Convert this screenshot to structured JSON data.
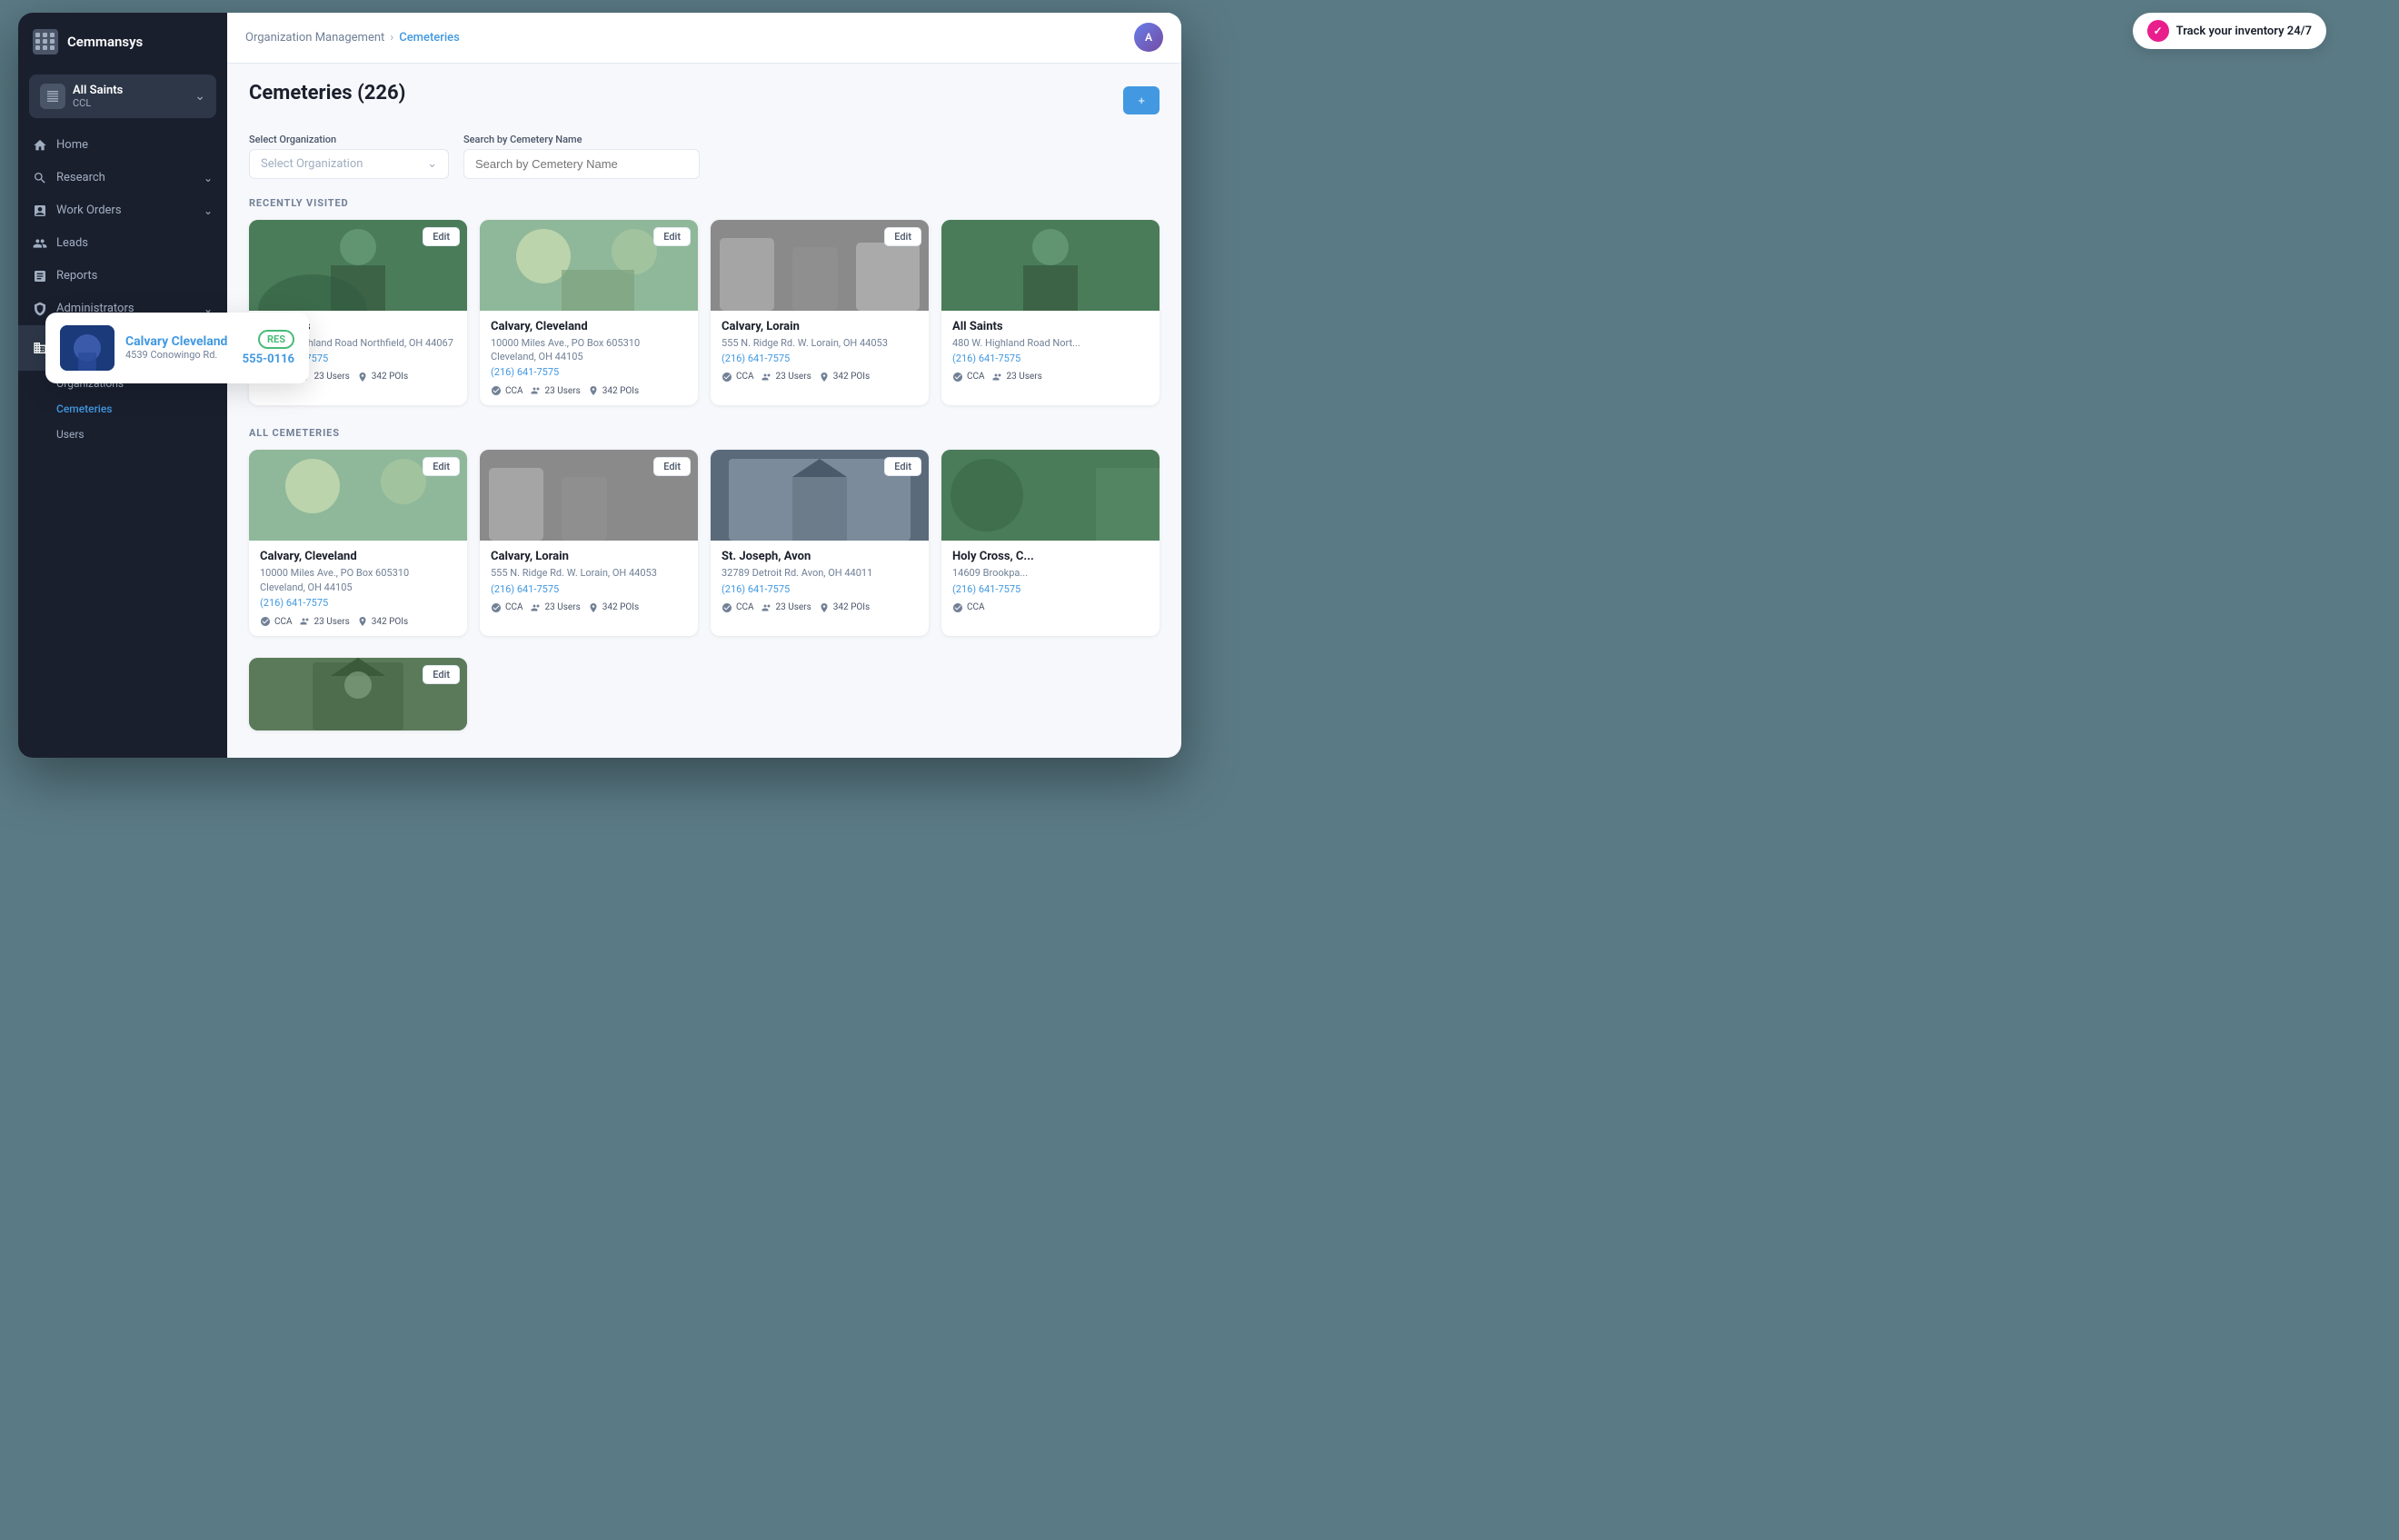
{
  "app": {
    "name": "Cemmansys"
  },
  "org": {
    "name": "All Saints",
    "code": "CCL"
  },
  "breadcrumb": {
    "parent": "Organization Management",
    "separator": "›",
    "current": "Cemeteries"
  },
  "page": {
    "title": "Cemeteries (226)"
  },
  "filters": {
    "org_label": "Select Organization",
    "org_placeholder": "Select Organization",
    "search_label": "Search by Cemetery Name",
    "search_placeholder": "Search by Cemetery Name"
  },
  "track_badge": "Track your inventory 24/7",
  "sections": {
    "recently_visited": "RECENTLY VISITED",
    "all_cemeteries": "ALL CEMETERIES"
  },
  "recently_visited": [
    {
      "name": "All Saints",
      "address": "480 W. Highland Road Northfield, OH 44067",
      "phone": "(216) 641-7575",
      "tags": [
        "CCA",
        "23 Users",
        "342 POIs"
      ],
      "img_class": "img-green"
    },
    {
      "name": "Calvary, Cleveland",
      "address": "10000 Miles Ave., PO Box 605310 Cleveland, OH 44105",
      "phone": "(216) 641-7575",
      "tags": [
        "CCA",
        "23 Users",
        "342 POIs"
      ],
      "img_class": "img-light-green"
    },
    {
      "name": "Calvary, Lorain",
      "address": "555 N. Ridge Rd. W. Lorain, OH 44053",
      "phone": "(216) 641-7575",
      "tags": [
        "CCA",
        "23 Users",
        "342 POIs"
      ],
      "img_class": "img-stone"
    },
    {
      "name": "All Saints",
      "address": "480 W. Highland Road Nort...",
      "phone": "(216) 641-7575",
      "tags": [
        "CCA",
        "23 Users"
      ],
      "img_class": "img-green"
    }
  ],
  "all_cemeteries": [
    {
      "name": "Calvary, Cleveland",
      "address": "10000 Miles Ave., PO Box 605310 Cleveland, OH 44105",
      "phone": "(216) 641-7575",
      "tags": [
        "CCA",
        "23 Users",
        "342 POIs"
      ],
      "img_class": "img-light-green"
    },
    {
      "name": "Calvary, Lorain",
      "address": "555 N. Ridge Rd. W. Lorain, OH 44053",
      "phone": "(216) 641-7575",
      "tags": [
        "CCA",
        "23 Users",
        "342 POIs"
      ],
      "img_class": "img-stone"
    },
    {
      "name": "St. Joseph, Avon",
      "address": "32789 Detroit Rd. Avon, OH 44011",
      "phone": "(216) 641-7575",
      "tags": [
        "CCA",
        "23 Users",
        "342 POIs"
      ],
      "img_class": "img-chapel"
    },
    {
      "name": "Holy Cross, C...",
      "address": "14609 Brookpa...",
      "phone": "(216) 641-7575",
      "tags": [
        "CCA"
      ],
      "img_class": "img-green"
    }
  ],
  "bottom_card": {
    "img_class": "img-chapel",
    "edit": "Edit"
  },
  "popup": {
    "title": "Calvary Cleveland",
    "address": "4539 Conowingo Rd.",
    "badge": "RES",
    "phone": "555-0116"
  },
  "nav": {
    "home": "Home",
    "research": "Research",
    "work_orders": "Work Orders",
    "leads": "Leads",
    "reports": "Reports",
    "administrators": "Administrators",
    "org_management": "Organization Management",
    "sub_orgs": "Organizations",
    "sub_cemeteries": "Cemeteries",
    "sub_users": "Users"
  },
  "edit_label": "Edit",
  "tags": {
    "cca": "CCA",
    "users_suffix": "Users",
    "pois_suffix": "POIs"
  }
}
